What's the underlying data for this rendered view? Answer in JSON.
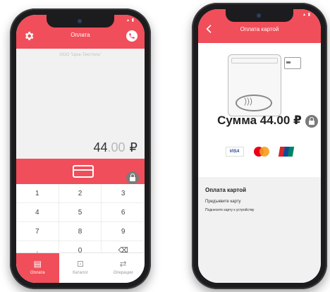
{
  "left_screen": {
    "title": "Оплата",
    "merchant": "ООО \"Цеш-Текстиль\"",
    "amount_integer": "44",
    "amount_decimal": ".00",
    "currency": "₽",
    "keypad": [
      "1",
      "2",
      "3",
      "4",
      "5",
      "6",
      "7",
      "8",
      "9",
      ".",
      "0",
      "⌫"
    ],
    "tabs": [
      {
        "label": "Оплата",
        "icon": "receipt-icon",
        "active": true
      },
      {
        "label": "Каталог",
        "icon": "bag-icon",
        "active": false
      },
      {
        "label": "Операции",
        "icon": "transfer-icon",
        "active": false
      }
    ]
  },
  "right_screen": {
    "title": "Оплата картой",
    "sum_text": "Сумма 44.00 ₽",
    "visa_label": "VISA",
    "info_heading": "Оплата картой",
    "info_line1": "Предъявите карту",
    "info_line2": "Поднесите карту к устройству"
  },
  "colors": {
    "accent": "#f04e5a",
    "lock": "#7b7b7b"
  }
}
